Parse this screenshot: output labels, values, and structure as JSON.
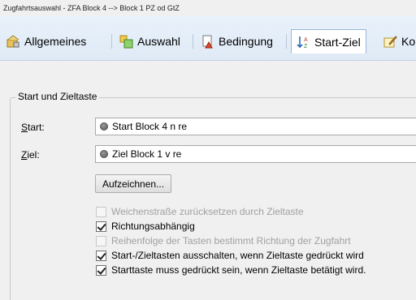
{
  "window": {
    "title": "Zugfahrtsauswahl - ZFA Block 4 --> Block 1 PZ od GtZ"
  },
  "tabs": [
    {
      "label": "Allgemeines",
      "icon": "settings-icon",
      "active": false
    },
    {
      "label": "Auswahl",
      "icon": "selection-icon",
      "active": false
    },
    {
      "label": "Bedingung",
      "icon": "condition-warning-icon",
      "active": false
    },
    {
      "label": "Start-Ziel",
      "icon": "sort-start-goal-icon",
      "active": true
    },
    {
      "label": "Ko",
      "icon": "edit-note-icon",
      "active": false
    }
  ],
  "group": {
    "title": "Start und Zieltaste",
    "start_label": "Start:",
    "start_value": "Start Block 4 n re",
    "ziel_label": "Ziel:",
    "ziel_value": "Ziel Block 1 v re",
    "record_button": "Aufzeichnen..."
  },
  "options": [
    {
      "label": "Weichenstraße zurücksetzen durch Zieltaste",
      "checked": false,
      "enabled": false
    },
    {
      "label": "Richtungsabhängig",
      "checked": true,
      "enabled": true
    },
    {
      "label": "Reihenfolge der Tasten bestimmt Richtung der Zugfahrt",
      "checked": false,
      "enabled": false
    },
    {
      "label": "Start-/Zieltasten ausschalten, wenn Zieltaste gedrückt wird",
      "checked": true,
      "enabled": true
    },
    {
      "label": "Starttaste muss gedrückt sein, wenn Zieltaste betätigt wird.",
      "checked": true,
      "enabled": true
    }
  ]
}
